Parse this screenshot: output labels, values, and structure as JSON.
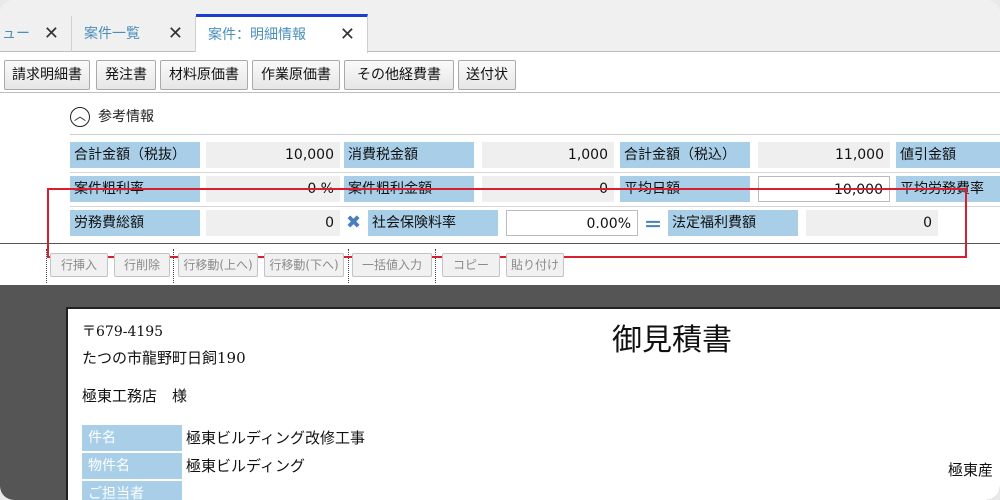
{
  "tabs": [
    {
      "label": "ュー",
      "close": "✕"
    },
    {
      "label": "案件一覧",
      "close": "✕"
    },
    {
      "label": "案件：明細情報",
      "close": "✕"
    }
  ],
  "doc_buttons": [
    "請求明細書",
    "発注書",
    "材料原価書",
    "作業原価書",
    "その他経費書",
    "送付状"
  ],
  "ref_section": {
    "toggle_icon": "chevron-up-icon",
    "title": "参考情報"
  },
  "row1": {
    "total_ex_label": "合計金額（税抜）",
    "total_ex_value": "10,000",
    "tax_label": "消費税金額",
    "tax_value": "1,000",
    "total_in_label": "合計金額（税込）",
    "total_in_value": "11,000",
    "discount_label": "値引金額"
  },
  "row2": {
    "gross_rate_label": "案件粗利率",
    "gross_rate_value": "0 %",
    "gross_amount_label": "案件粗利金額",
    "gross_amount_value": "0",
    "avg_daily_label": "平均日額",
    "avg_daily_value": "10,000",
    "avg_labor_label": "平均労務費率"
  },
  "row3": {
    "labor_total_label": "労務費総額",
    "labor_total_value": "0",
    "multiply_op": "✖",
    "insurance_rate_label": "社会保険料率",
    "insurance_rate_value": "0.00%",
    "equals_op": "＝",
    "welfare_label": "法定福利費額",
    "welfare_value": "0"
  },
  "row_actions": [
    "行挿入",
    "行削除",
    "行移動(上へ)",
    "行移動(下へ)",
    "一括値入力",
    "コピー",
    "貼り付け"
  ],
  "preview": {
    "postal": "〒679-4195",
    "address": "たつの市龍野町日飼190",
    "recipient": "極東工務店　様",
    "title": "御見積書",
    "company_partial": "極東産",
    "fields": [
      {
        "label": "件名",
        "value": "極東ビルディング改修工事"
      },
      {
        "label": "物件名",
        "value": "極東ビルディング"
      },
      {
        "label": "ご担当者",
        "value": ""
      }
    ]
  }
}
